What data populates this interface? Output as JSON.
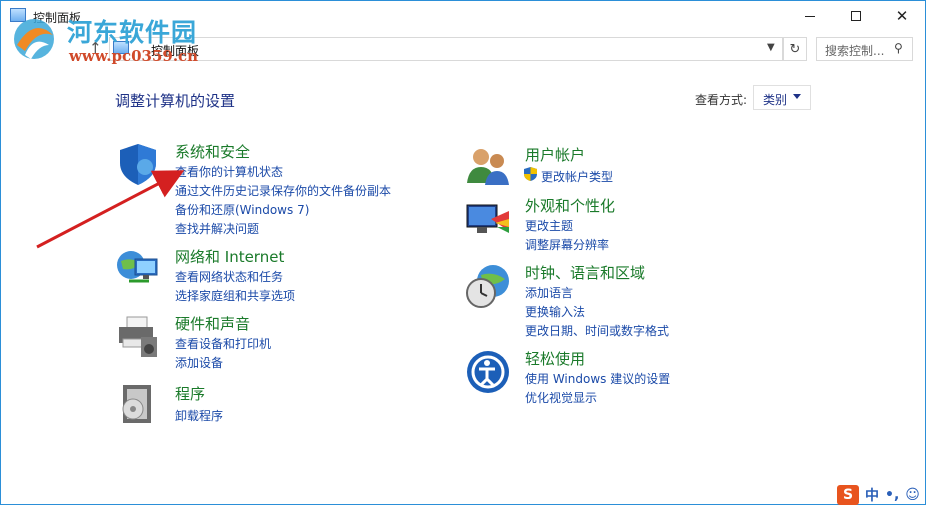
{
  "window": {
    "title": "控制面板"
  },
  "watermark": {
    "title": "河东软件园",
    "url": "www.pc0359.cn"
  },
  "address": {
    "path": "控制面板",
    "search_placeholder": "搜索控制..."
  },
  "page": {
    "title": "调整计算机的设置",
    "view_label": "查看方式:",
    "view_value": "类别"
  },
  "left_categories": [
    {
      "title": "系统和安全",
      "links": [
        "查看你的计算机状态",
        "通过文件历史记录保存你的文件备份副本",
        "备份和还原(Windows 7)",
        "查找并解决问题"
      ],
      "icon": "shield-icon"
    },
    {
      "title": "网络和 Internet",
      "links": [
        "查看网络状态和任务",
        "选择家庭组和共享选项"
      ],
      "icon": "network-globe-icon"
    },
    {
      "title": "硬件和声音",
      "links": [
        "查看设备和打印机",
        "添加设备"
      ],
      "icon": "printer-icon"
    },
    {
      "title": "程序",
      "links": [
        "卸载程序"
      ],
      "icon": "programs-icon"
    }
  ],
  "right_categories": [
    {
      "title": "用户帐户",
      "links": [
        "更改帐户类型"
      ],
      "icon": "users-icon"
    },
    {
      "title": "外观和个性化",
      "links": [
        "更改主题",
        "调整屏幕分辨率"
      ],
      "icon": "appearance-icon"
    },
    {
      "title": "时钟、语言和区域",
      "links": [
        "添加语言",
        "更换输入法",
        "更改日期、时间或数字格式"
      ],
      "icon": "clock-globe-icon"
    },
    {
      "title": "轻松使用",
      "links": [
        "使用 Windows 建议的设置",
        "优化视觉显示"
      ],
      "icon": "ease-of-access-icon"
    }
  ],
  "tray": {
    "ime_logo": "S",
    "ime_mode": "中",
    "punct": "•,"
  },
  "colors": {
    "link": "#1b4aa8",
    "category": "#1a7a2a",
    "title": "#1e3287",
    "arrow": "#d42020"
  }
}
